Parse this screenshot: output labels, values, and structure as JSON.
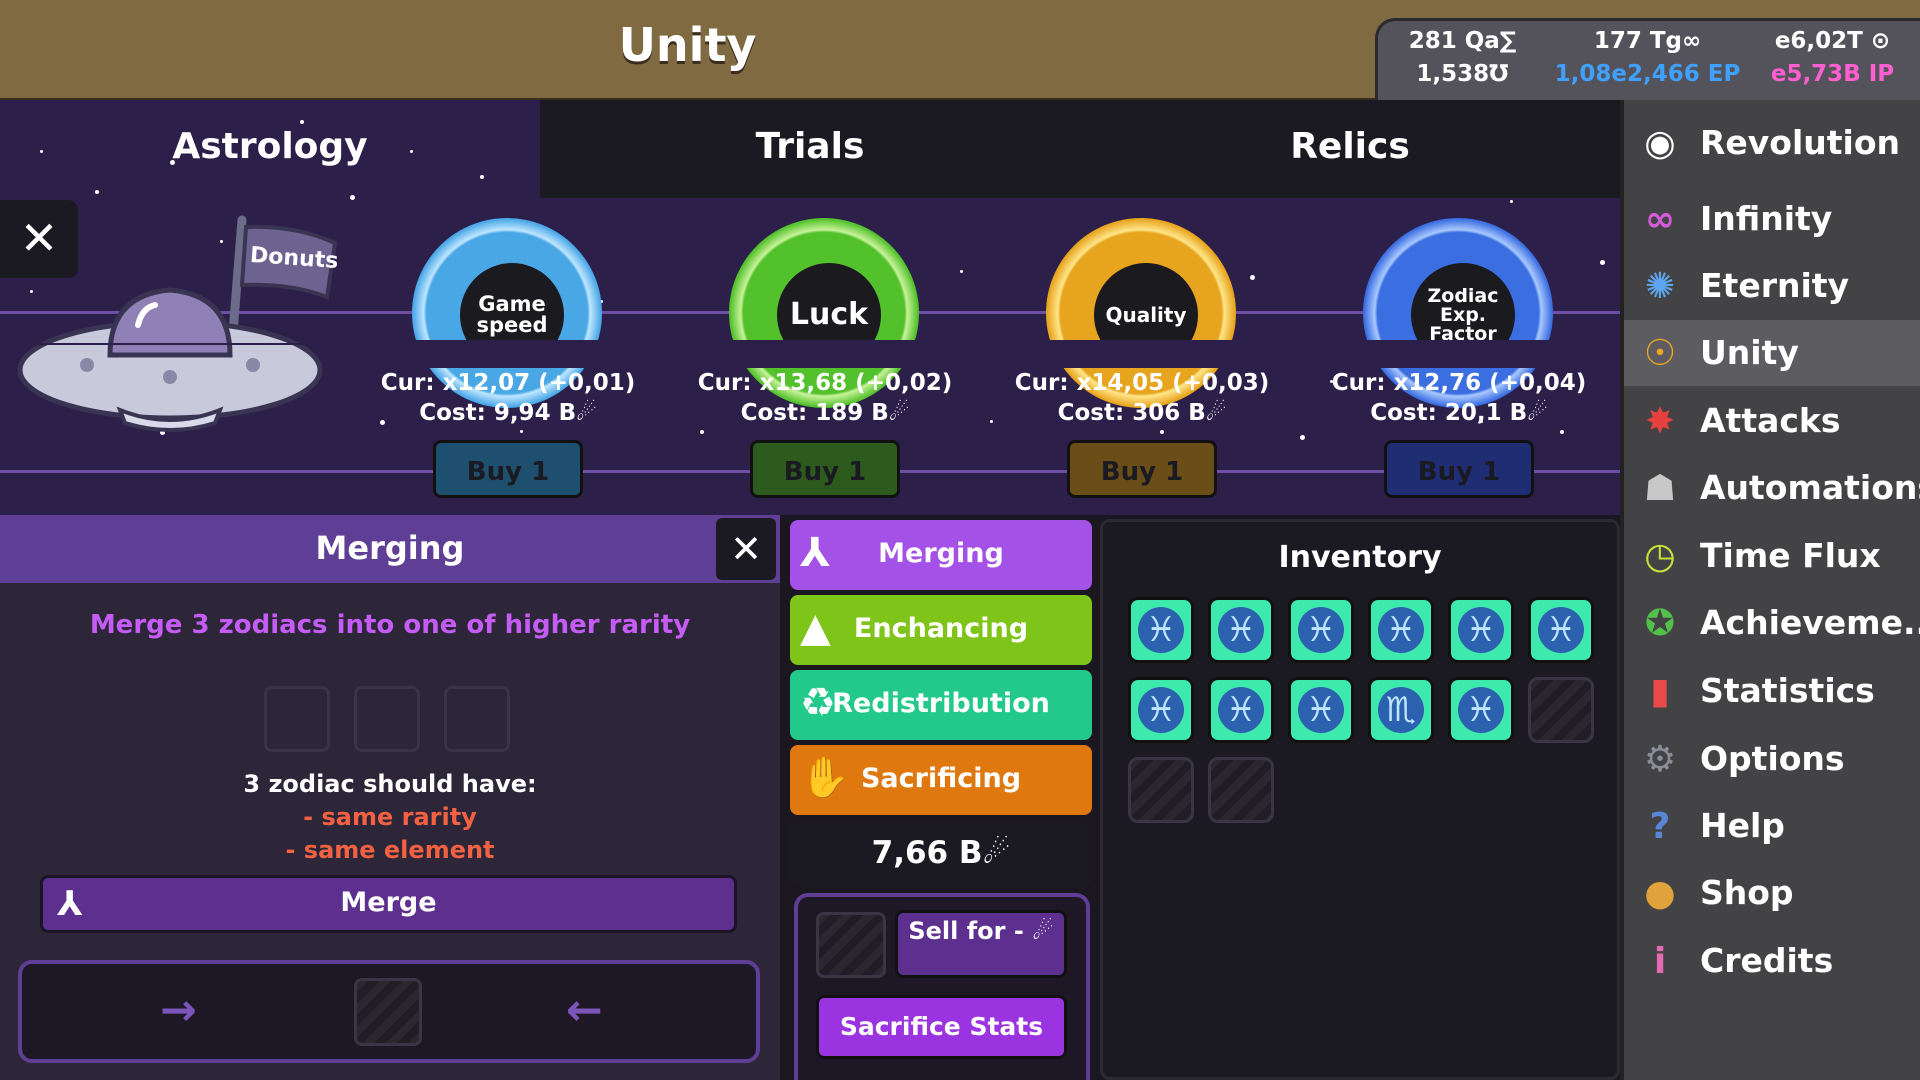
{
  "header": {
    "title": "Unity"
  },
  "currencies": {
    "row1": [
      "281 Qa∑",
      "177 Tg∞",
      "e6,02T ⊙"
    ],
    "row2": [
      "1,538℧",
      "1,08e2,466 EP",
      "e5,73B IP"
    ]
  },
  "tabs": [
    "Astrology",
    "Trials",
    "Relics"
  ],
  "flag_label": "Donuts",
  "upgrades": [
    {
      "name": "Game speed",
      "cur": "Cur: x12,07 (+0,01)",
      "cost": "Cost: 9,94 B☄",
      "buy": "Buy 1",
      "color": "#4aa7e6"
    },
    {
      "name": "Luck",
      "cur": "Cur: x13,68 (+0,02)",
      "cost": "Cost: 189 B☄",
      "buy": "Buy 1",
      "color": "#53c12c"
    },
    {
      "name": "Quality",
      "cur": "Cur: x14,05 (+0,03)",
      "cost": "Cost: 306 B☄",
      "buy": "Buy 1",
      "color": "#e7a41e"
    },
    {
      "name": "Zodiac Exp. Factor",
      "cur": "Cur: x12,76 (+0,04)",
      "cost": "Cost: 20,1 B☄",
      "buy": "Buy 1",
      "color": "#3b6ee0"
    }
  ],
  "merging": {
    "title": "Merging",
    "description": "Merge 3 zodiacs into one of higher rarity",
    "rule_title": "3 zodiac should have:",
    "rule1": "- same rarity",
    "rule2": "- same element",
    "merge_button": "Merge",
    "arrow_left": "→",
    "arrow_right": "←"
  },
  "actions": [
    "Merging",
    "Enchancing",
    "Redistribution",
    "Sacrificing"
  ],
  "balance": "7,66 B☄",
  "sell_label": "Sell for - ☄",
  "sacrifice_stats": "Sacrifice Stats",
  "inventory": {
    "title": "Inventory",
    "items": [
      "♓",
      "♓",
      "♓",
      "♓",
      "♓",
      "♓",
      "♓",
      "♓",
      "♓",
      "♏",
      "♓"
    ]
  },
  "sidebar": [
    {
      "label": "Revolution",
      "icon": "◉",
      "color": "#ffffff"
    },
    {
      "label": "Infinity",
      "icon": "∞",
      "color": "#d65bd9"
    },
    {
      "label": "Eternity",
      "icon": "✺",
      "color": "#5ea6ef"
    },
    {
      "label": "Unity",
      "icon": "☉",
      "color": "#f2a51e"
    },
    {
      "label": "Attacks",
      "icon": "✸",
      "color": "#e5423f"
    },
    {
      "label": "Automations",
      "icon": "☗",
      "color": "#c8c8c8"
    },
    {
      "label": "Time Flux",
      "icon": "◷",
      "color": "#c6e03a"
    },
    {
      "label": "Achieveme...",
      "icon": "✪",
      "color": "#52c14a"
    },
    {
      "label": "Statistics",
      "icon": "▮",
      "color": "#e84a4a"
    },
    {
      "label": "Options",
      "icon": "⚙",
      "color": "#8b8d99"
    },
    {
      "label": "Help",
      "icon": "?",
      "color": "#5a86d8"
    },
    {
      "label": "Shop",
      "icon": "●",
      "color": "#e0a23a"
    },
    {
      "label": "Credits",
      "icon": "i",
      "color": "#e36bb1"
    }
  ]
}
